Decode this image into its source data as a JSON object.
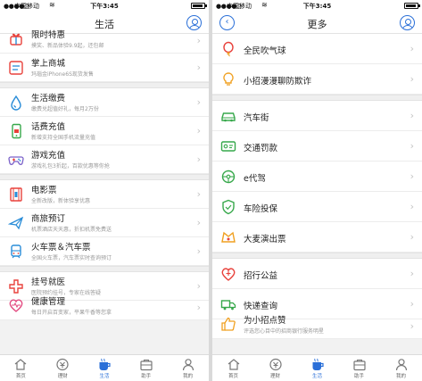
{
  "status_bar": {
    "signal": "●●●●○",
    "carrier": "中国移动",
    "wifi_icon": "wifi-icon",
    "time": "下午3:45",
    "battery_icon": "battery-icon"
  },
  "colors": {
    "accent": "#2a6fd8",
    "icon_red": "#e8413b",
    "icon_blue": "#2a8dd8",
    "icon_green": "#37a84b",
    "icon_orange": "#f0a020",
    "icon_pink": "#e2447c",
    "icon_purple": "#7b61c9"
  },
  "left": {
    "title": "生活",
    "groups": [
      [
        {
          "title": "限时特惠",
          "subtitle": "摸奖、新品体验9.9起，还包邮",
          "icon": "gift-icon",
          "partial": true
        },
        {
          "title": "掌上商城",
          "subtitle": "玛瑙金iPhone6S现货发售",
          "icon": "shop-icon"
        }
      ],
      [
        {
          "title": "生活缴费",
          "subtitle": "缴费兑超值好礼，每月2万份",
          "icon": "water-drop-icon"
        },
        {
          "title": "话费充值",
          "subtitle": "新增支持全国手机流量充值",
          "icon": "phone-icon"
        },
        {
          "title": "游戏充值",
          "subtitle": "游戏礼包3折起，百款优惠等你抢",
          "icon": "gamepad-icon"
        }
      ],
      [
        {
          "title": "电影票",
          "subtitle": "全新改版，新体验享优惠",
          "icon": "film-icon"
        },
        {
          "title": "商旅预订",
          "subtitle": "机票酒店天天惠，折扣机票免费送",
          "icon": "plane-icon"
        },
        {
          "title": "火车票＆汽车票",
          "subtitle": "全国火车票，汽车票实时查询预订",
          "icon": "train-icon"
        }
      ],
      [
        {
          "title": "挂号就医",
          "subtitle": "医院预约挂号，专家在线答疑",
          "icon": "medical-cross-icon"
        },
        {
          "title": "健康管理",
          "subtitle": "每日开启百变家，平果牛香等您拿",
          "icon": "heart-pulse-icon",
          "partial": true
        }
      ]
    ],
    "tabs": [
      {
        "label": "首页",
        "icon": "home-icon"
      },
      {
        "label": "理财",
        "icon": "finance-icon"
      },
      {
        "label": "生活",
        "icon": "life-cup-icon",
        "active": true
      },
      {
        "label": "助手",
        "icon": "assistant-bag-icon"
      },
      {
        "label": "我的",
        "icon": "profile-icon"
      }
    ]
  },
  "right": {
    "title": "更多",
    "groups": [
      [
        {
          "title": "全民吹气球",
          "icon": "balloon-icon"
        },
        {
          "title": "小招漫漫聊防欺诈",
          "icon": "lightbulb-icon"
        }
      ],
      [
        {
          "title": "汽车街",
          "icon": "car-icon"
        },
        {
          "title": "交通罚款",
          "icon": "ticket-card-icon"
        },
        {
          "title": "e代驾",
          "icon": "steering-wheel-icon"
        },
        {
          "title": "车险投保",
          "icon": "shield-icon"
        },
        {
          "title": "大麦演出票",
          "icon": "show-ticket-icon"
        }
      ],
      [
        {
          "title": "招行公益",
          "icon": "charity-heart-icon"
        },
        {
          "title": "快递查询",
          "icon": "delivery-truck-icon"
        },
        {
          "title": "为小招点赞",
          "subtitle": "评选您心目中的招商银行服务明星",
          "icon": "thumb-up-icon",
          "partial": true
        }
      ]
    ],
    "tabs": [
      {
        "label": "首页",
        "icon": "home-icon"
      },
      {
        "label": "理财",
        "icon": "finance-icon"
      },
      {
        "label": "生活",
        "icon": "life-cup-icon",
        "active": true
      },
      {
        "label": "助手",
        "icon": "assistant-bag-icon"
      },
      {
        "label": "我的",
        "icon": "profile-icon"
      }
    ]
  }
}
